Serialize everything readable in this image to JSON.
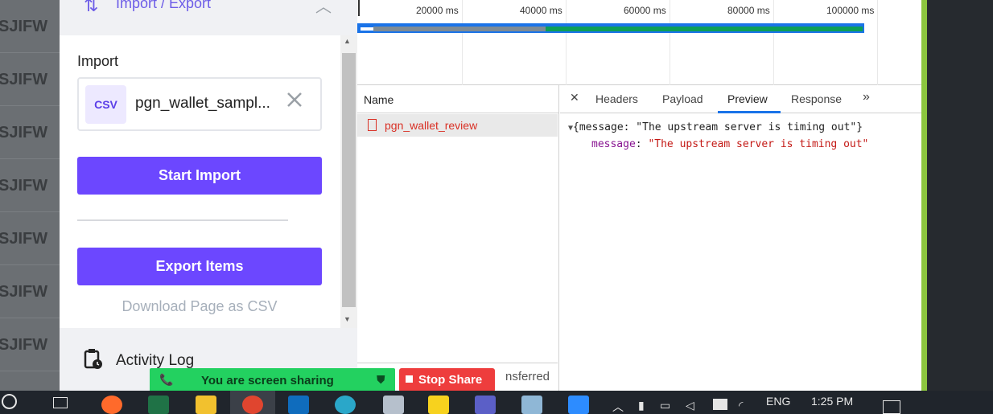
{
  "background_rows": [
    "SJIFW",
    "SJIFW",
    "SJIFW",
    "SJIFW",
    "SJIFW",
    "SJIFW",
    "SJIFW"
  ],
  "panel": {
    "section_title": "Import / Export",
    "import_label": "Import",
    "file_tag": "CSV",
    "file_name": "pgn_wallet_sampl...",
    "start_import": "Start Import",
    "export_items": "Export Items",
    "download_link": "Download Page as CSV",
    "activity_log": "Activity Log"
  },
  "devtools": {
    "timeline_ticks": [
      "20000 ms",
      "40000 ms",
      "60000 ms",
      "80000 ms",
      "100000 ms"
    ],
    "name_header": "Name",
    "request_name": "pgn_wallet_review",
    "status_text": "nsferred",
    "tabs": [
      "Headers",
      "Payload",
      "Preview",
      "Response"
    ],
    "active_tab": "Preview",
    "preview_object_line": "{message: \"The upstream server is timing out\"}",
    "preview_key": "message",
    "preview_value": "\"The upstream server is timing out\""
  },
  "share_banner": {
    "text": "You are screen sharing",
    "stop_label": "Stop Share"
  },
  "taskbar": {
    "language": "ENG",
    "time": "1:25 PM"
  },
  "colors": {
    "accent_purple": "#6c47ff",
    "error_red": "#d93025",
    "share_green": "#23d160",
    "stop_red": "#ee3d3d",
    "devtools_blue": "#1a73e8"
  }
}
